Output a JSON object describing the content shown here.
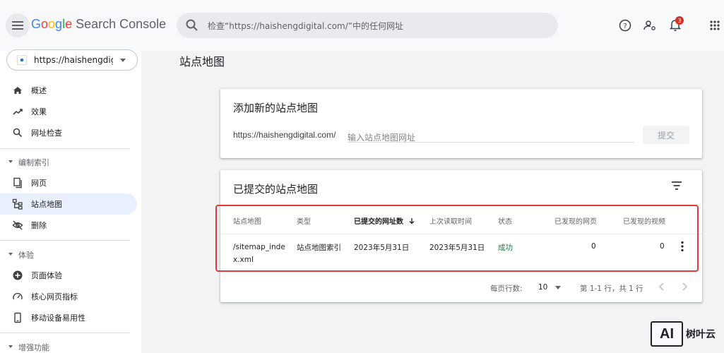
{
  "header": {
    "logo": {
      "G": "G",
      "o1": "o",
      "o2": "o",
      "g": "g",
      "l": "l",
      "e": "e",
      "rest": " Search Console"
    },
    "search_placeholder": "检查“https://haishengdigital.com/”中的任何网址",
    "notification_count": "3"
  },
  "sidebar": {
    "property": "https://haishengdigital.com/",
    "items": [
      {
        "label": "概述",
        "icon": "home-icon"
      },
      {
        "label": "效果",
        "icon": "trending-up-icon"
      },
      {
        "label": "网址检查",
        "icon": "search-icon"
      }
    ],
    "sections": [
      {
        "label": "编制索引",
        "items": [
          {
            "label": "网页",
            "icon": "pages-icon"
          },
          {
            "label": "站点地图",
            "icon": "sitemap-icon",
            "active": true
          },
          {
            "label": "删除",
            "icon": "visibility-off-icon"
          }
        ]
      },
      {
        "label": "体验",
        "items": [
          {
            "label": "页面体验",
            "icon": "add-circle-icon"
          },
          {
            "label": "核心网页指标",
            "icon": "speed-icon"
          },
          {
            "label": "移动设备易用性",
            "icon": "phone-icon"
          }
        ]
      },
      {
        "label": "增强功能"
      }
    ]
  },
  "main": {
    "page_title": "站点地图",
    "add_card": {
      "title": "添加新的站点地图",
      "prefix": "https://haishengdigital.com/",
      "input_placeholder": "输入站点地图网址",
      "submit_label": "提交"
    },
    "submitted_card": {
      "title": "已提交的站点地图",
      "columns": [
        "站点地图",
        "类型",
        "已提交的网址数",
        "上次读取时间",
        "状态",
        "已发现的网页",
        "已发现的视频"
      ],
      "rows": [
        {
          "sitemap_line1": "/sitemap_inde",
          "sitemap_line2": "x.xml",
          "type": "站点地图索引",
          "submitted": "2023年5月31日",
          "last_read": "2023年5月31日",
          "status": "成功",
          "pages": "0",
          "videos": "0"
        }
      ],
      "pager": {
        "rows_per_page_label": "每页行数:",
        "rows_per_page": "10",
        "range": "第 1-1 行，共 1 行"
      }
    }
  },
  "watermark": {
    "logo": "AI",
    "text": "树叶云"
  },
  "colors": {
    "accent": "#1a73e8",
    "active_bg": "#e8f0fe",
    "success": "#188038",
    "highlight": "#e53935"
  }
}
